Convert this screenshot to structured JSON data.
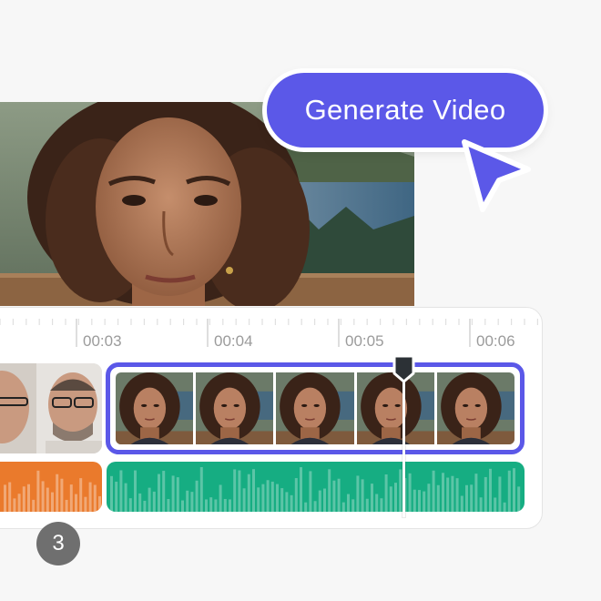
{
  "generate_button": {
    "label": "Generate Video"
  },
  "timeline": {
    "ticks": [
      "00:03",
      "00:04",
      "00:05",
      "00:06"
    ]
  },
  "badge": {
    "count": "3"
  },
  "colors": {
    "accent": "#5b58e8",
    "audio_left": "#ea7a2c",
    "audio_main": "#16ad82",
    "badge": "#6f6f6f"
  },
  "icons": {
    "cursor": "cursor-arrow-icon",
    "playhead": "playhead-handle-icon"
  }
}
